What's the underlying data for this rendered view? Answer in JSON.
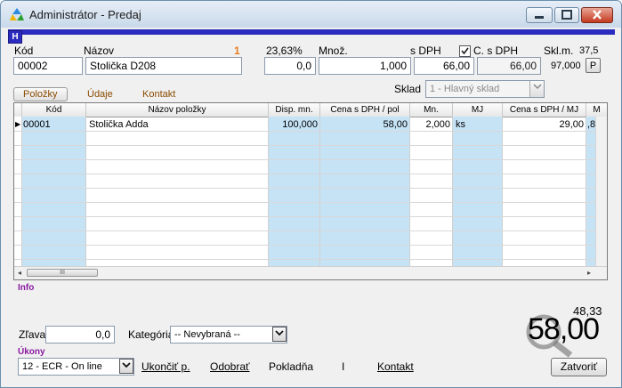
{
  "window": {
    "title": "Administrátor - Predaj",
    "badge": "H",
    "minimize": "‒",
    "maximize": "□",
    "close": "✕"
  },
  "header_fields": {
    "kod_label": "Kód",
    "kod_value": "00002",
    "nazov_label": "Názov",
    "nazov_value": "Stolička D208",
    "count_marker": "1",
    "vat_rate": "23,63%",
    "vat_value": "0,0",
    "mnoz_label": "Množ.",
    "mnoz_value": "1,000",
    "sdph_label": "s DPH",
    "sdph_value": "66,00",
    "csdph_checked": true,
    "csdph_label": "C. s DPH",
    "csdph_value": "66,00",
    "sklm_label": "Skl.m.",
    "sklm_value": "37,5",
    "sklm_sub": "97,000",
    "p_button": "P"
  },
  "tabs": {
    "polozky": "Položky",
    "udaje": "Údaje",
    "kontakt": "Kontakt"
  },
  "warehouse": {
    "label": "Sklad",
    "value": "1 - Hlavný sklad"
  },
  "grid": {
    "headers": [
      "Kód",
      "Názov položky",
      "Disp. mn.",
      "Cena s DPH / pol",
      "Mn.",
      "MJ",
      "Cena s DPH / MJ",
      "M"
    ],
    "rows": [
      {
        "marker": "▶",
        "kod": "00001",
        "nazov": "Stolička Adda",
        "disp": "100,000",
        "cena_pol": "58,00",
        "mn": "2,000",
        "mj": "ks",
        "cena_mj": "29,00",
        "m": ",8"
      }
    ],
    "scroll_thumb": "III",
    "scroll_left": "◂",
    "scroll_right": "▸"
  },
  "info": {
    "label": "Info"
  },
  "footer": {
    "zlava_label": "Zľava",
    "zlava_value": "0,0",
    "kategoria_label": "Kategória",
    "kategoria_value": "-- Nevybraná --",
    "subtotal": "48,33",
    "total": "58,00",
    "ukony_label": "Úkony",
    "ukony_value": "12 - ECR - On line",
    "ukoncit": "Ukončiť p.",
    "odobrat": "Odobrať",
    "pokladna": "Pokladňa",
    "sep": "I",
    "kontakt": "Kontakt",
    "zatvorit": "Zatvoriť"
  },
  "colors": {
    "accent_blue": "#2b2bbf",
    "grid_highlight": "#c6e3f6",
    "tab_text": "#8a4a00",
    "section_purple": "#8a1aa0",
    "marker_orange": "#e87a1e"
  }
}
